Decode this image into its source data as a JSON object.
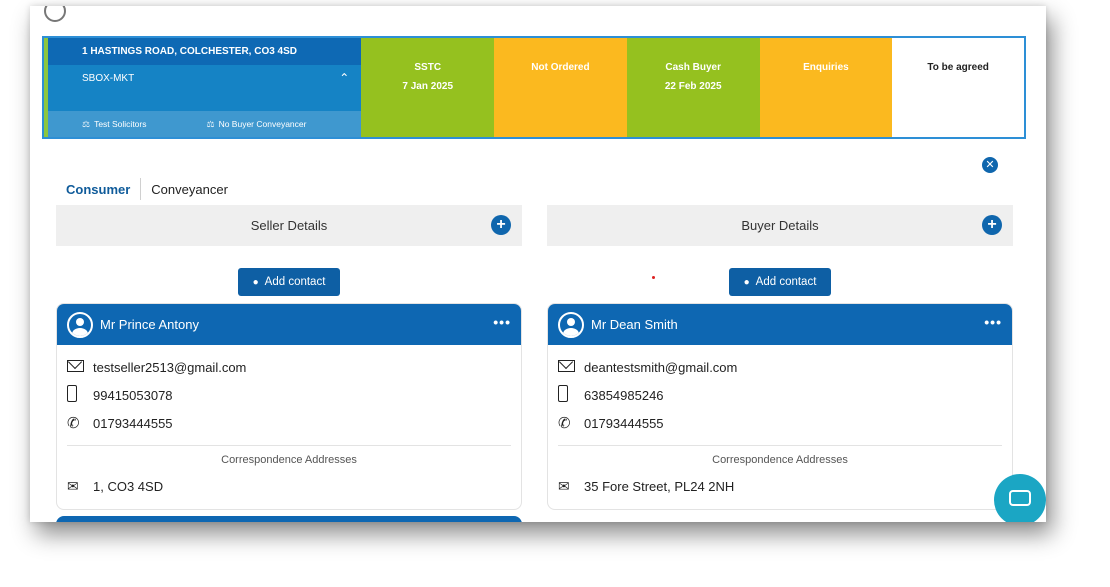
{
  "property": {
    "address": "1 HASTINGS ROAD, COLCHESTER, CO3 4SD",
    "reference": "SBOX-MKT",
    "seller_solicitor": "Test Solicitors",
    "buyer_conveyancer": "No Buyer Conveyancer"
  },
  "stages": [
    {
      "title": "SSTC",
      "date": "7 Jan 2025",
      "color": "#95c11f"
    },
    {
      "title": "Not Ordered",
      "date": "",
      "color": "#fbb91f"
    },
    {
      "title": "Cash Buyer",
      "date": "22 Feb 2025",
      "color": "#95c11f"
    },
    {
      "title": "Enquiries",
      "date": "",
      "color": "#fbb91f"
    },
    {
      "title": "To be agreed",
      "date": "",
      "color": "#ffffff"
    }
  ],
  "tabs": [
    "Consumer",
    "Conveyancer"
  ],
  "seller": {
    "section_title": "Seller Details",
    "add_contact": "Add contact",
    "name": "Mr Prince Antony",
    "email": "testseller2513@gmail.com",
    "mobile": "99415053078",
    "phone": "01793444555",
    "corr_label": "Correspondence Addresses",
    "corr_address": "1, CO3 4SD"
  },
  "buyer": {
    "section_title": "Buyer Details",
    "add_contact": "Add contact",
    "name": "Mr Dean Smith",
    "email": "deantestsmith@gmail.com",
    "mobile": "63854985246",
    "phone": "01793444555",
    "corr_label": "Correspondence Addresses",
    "corr_address": "35 Fore Street, PL24 2NH"
  },
  "icons": {
    "close": "close-icon",
    "plus": "plus-icon",
    "chat": "chat-icon"
  }
}
